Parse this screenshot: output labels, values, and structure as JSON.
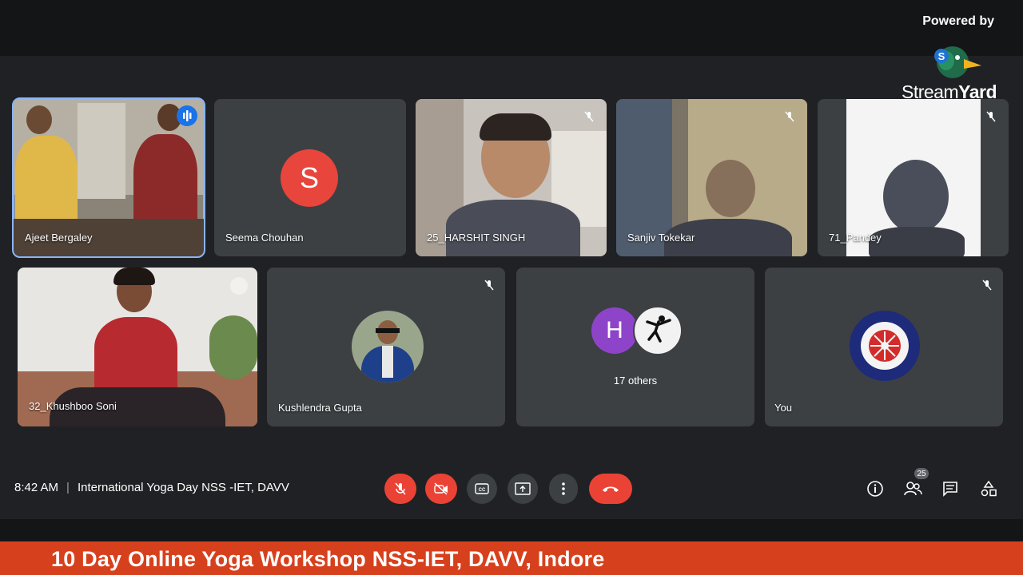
{
  "overlay": {
    "powered_by": "Powered by",
    "brand_stream": "Stream",
    "brand_yard": "Yard",
    "brand_badge": "S"
  },
  "participants": {
    "p1": {
      "name": "Ajeet Bergaley"
    },
    "p2": {
      "name": "Seema Chouhan",
      "initial": "S",
      "avatar_color": "#e8453c"
    },
    "p3": {
      "name": "25_HARSHIT SINGH"
    },
    "p4": {
      "name": "Sanjiv Tokekar"
    },
    "p5": {
      "name": "71_Pandey"
    },
    "p6": {
      "name": "32_Khushboo Soni"
    },
    "p7": {
      "name": "Kushlendra Gupta"
    },
    "others": {
      "initial": "H",
      "label": "17 others",
      "avatar_color": "#8e44c9"
    },
    "you": {
      "name": "You"
    }
  },
  "meeting": {
    "time": "8:42 AM",
    "separator": "|",
    "title": "International Yoga Day NSS -IET, DAVV"
  },
  "toolbar": {
    "people_count": "25",
    "end_call_color": "#ea4335"
  },
  "banner": {
    "text": "10 Day Online Yoga Workshop NSS-IET, DAVV, Indore"
  }
}
